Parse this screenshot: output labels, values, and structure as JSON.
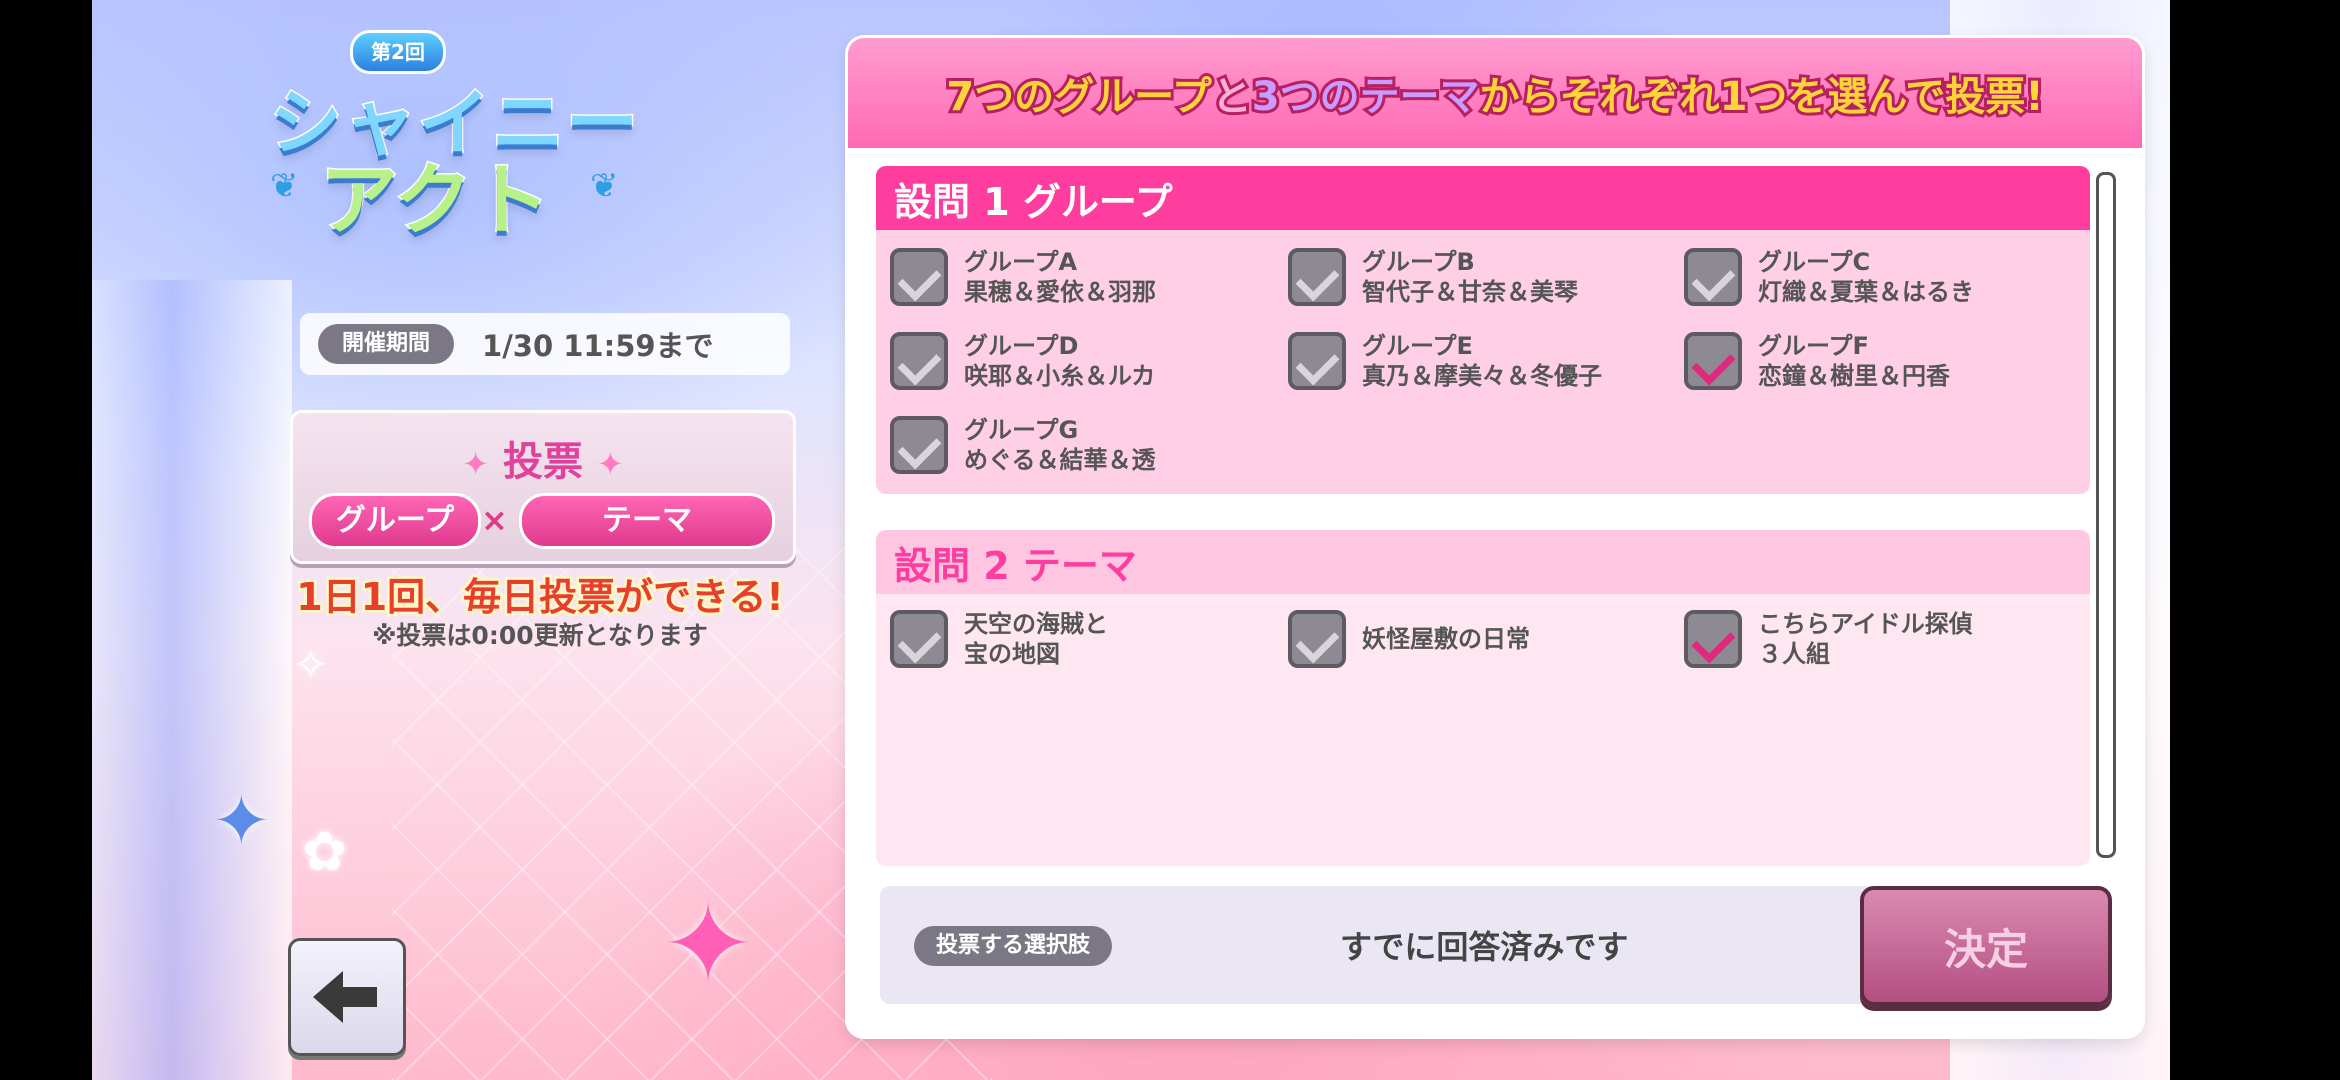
{
  "logo": {
    "badge": "第2回",
    "line1": "シャイニー",
    "line2": "アクト"
  },
  "period": {
    "label": "開催期間",
    "value": "1/30 11:59まで"
  },
  "vote_card": {
    "title": "投票",
    "pill_left": "グループ",
    "times": "×",
    "pill_right": "テーマ"
  },
  "daily_text": "1日1回、毎日投票ができる!",
  "note": "※投票は0:00更新となります",
  "banner": {
    "part1": "7つのグループ",
    "part2": "と",
    "part3": "3つのテーマ",
    "part4": "からそれぞれ1つを選んで投票!"
  },
  "question1": {
    "title": "設問 1  グループ",
    "options": [
      {
        "line1": "グループA",
        "line2": "果穂＆愛依＆羽那",
        "checked": false
      },
      {
        "line1": "グループB",
        "line2": "智代子＆甘奈＆美琴",
        "checked": false
      },
      {
        "line1": "グループC",
        "line2": "灯織＆夏葉＆はるき",
        "checked": false
      },
      {
        "line1": "グループD",
        "line2": "咲耶＆小糸＆ルカ",
        "checked": false
      },
      {
        "line1": "グループE",
        "line2": "真乃＆摩美々＆冬優子",
        "checked": false
      },
      {
        "line1": "グループF",
        "line2": "恋鐘＆樹里＆円香",
        "checked": true
      },
      {
        "line1": "グループG",
        "line2": "めぐる＆結華＆透",
        "checked": false
      }
    ]
  },
  "question2": {
    "title": "設問 2  テーマ",
    "options": [
      {
        "line1": "天空の海賊と",
        "line2": "宝の地図",
        "checked": false
      },
      {
        "line1": "妖怪屋敷の日常",
        "line2": "",
        "checked": false
      },
      {
        "line1": "こちらアイドル探偵",
        "line2": "３人組",
        "checked": true
      }
    ]
  },
  "footer": {
    "label": "投票する選択肢",
    "status": "すでに回答済みです"
  },
  "decide_button": "決定",
  "colors": {
    "accent_pink": "#ff3d9e",
    "check_mark_on": "#e0287f",
    "banner_text": "#ffd43a"
  },
  "icons": {
    "back": "left-arrow-icon",
    "checkbox": "check-icon"
  }
}
